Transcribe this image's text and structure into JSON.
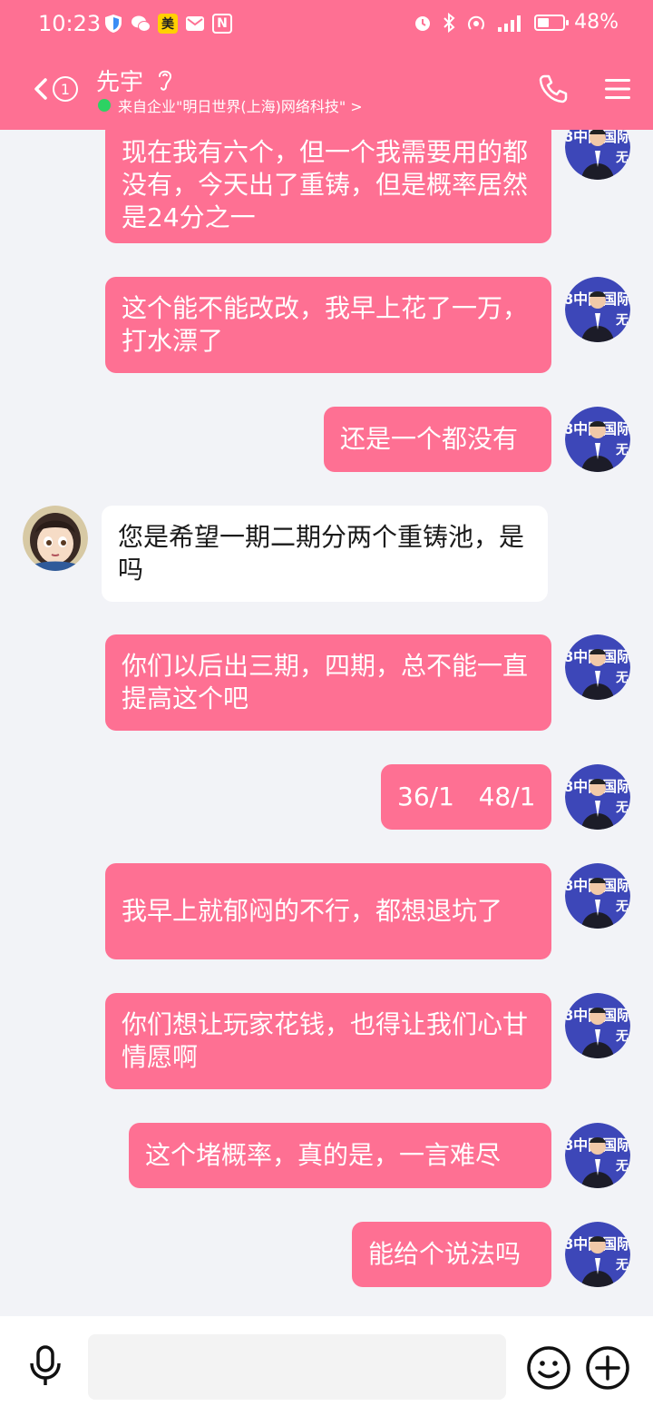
{
  "status_bar": {
    "time": "10:23",
    "battery": "48%",
    "battery_level": 0.48,
    "left_icons": [
      "shield-icon",
      "wechat-icon",
      "meituan-icon",
      "mail-icon",
      "nfc-icon"
    ],
    "meituan_label": "美",
    "nfc_label": "N"
  },
  "header": {
    "back_badge": "①",
    "contact_name": "先宇",
    "company": "来自企业\"明日世界(上海)网络科技\" >",
    "accent_color": "#fe7093"
  },
  "messages": [
    {
      "from": "me",
      "text": "现在我有六个，但一个我需要用的都没有，今天出了重铸，但是概率居然是24分之一"
    },
    {
      "from": "me",
      "text": "这个能不能改改，我早上花了一万，打水漂了"
    },
    {
      "from": "me",
      "text": "还是一个都没有"
    },
    {
      "from": "other",
      "text": "您是希望一期二期分两个重铸池，是吗"
    },
    {
      "from": "me",
      "text": "你们以后出三期，四期，总不能一直提高这个吧"
    },
    {
      "from": "me",
      "text": "36/1   48/1"
    },
    {
      "from": "me",
      "text": "我早上就郁闷的不行，都想退坑了"
    },
    {
      "from": "me",
      "text": "你们想让玩家花钱，也得让我们心甘情愿啊"
    },
    {
      "from": "me",
      "text": "这个堵概率，真的是，一言难尽"
    },
    {
      "from": "me",
      "text": "能给个说法吗"
    }
  ],
  "avatar_text": "8中国国际",
  "avatar_text2": "无",
  "input": {
    "placeholder": "",
    "value": ""
  }
}
